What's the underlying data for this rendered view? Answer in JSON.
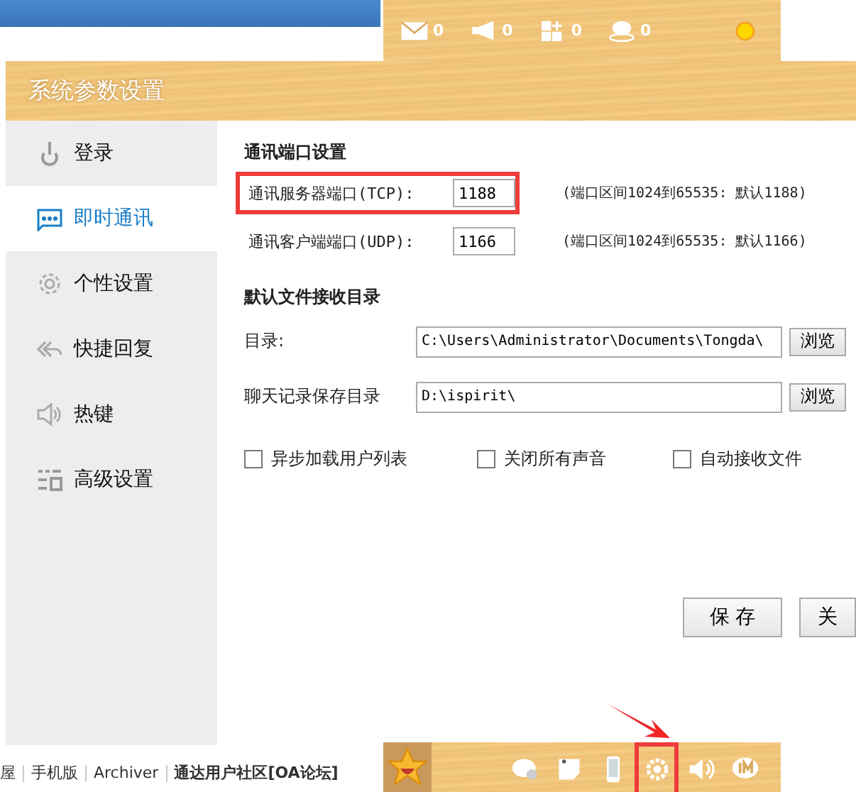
{
  "background_page": {
    "footer": [
      {
        "text": "屋",
        "bold": false
      },
      {
        "text": "手机版",
        "bold": false
      },
      {
        "text": "Archiver",
        "bold": false
      },
      {
        "text": "通达用户社区[OA论坛]",
        "bold": true
      }
    ]
  },
  "top_toolbar": {
    "counters": [
      {
        "kind": "mail",
        "count": "0"
      },
      {
        "kind": "megaphone",
        "count": "0"
      },
      {
        "kind": "apps",
        "count": "0"
      },
      {
        "kind": "chat",
        "count": "0"
      }
    ]
  },
  "dialog": {
    "title": "系统参数设置",
    "nav": [
      {
        "label": "登录",
        "kind": "power",
        "selected": false
      },
      {
        "label": "即时通讯",
        "kind": "message",
        "selected": true
      },
      {
        "label": "个性设置",
        "kind": "gear",
        "selected": false
      },
      {
        "label": "快捷回复",
        "kind": "reply",
        "selected": false
      },
      {
        "label": "热键",
        "kind": "speaker",
        "selected": false
      },
      {
        "label": "高级设置",
        "kind": "advanced",
        "selected": false
      }
    ],
    "port_section": "通讯端口设置",
    "ports": [
      {
        "label": "通讯服务器端口(TCP):",
        "value": "1188",
        "hint": "(端口区间1024到65535: 默认1188)",
        "highlighted": true
      },
      {
        "label": "通讯客户端端口(UDP):",
        "value": "1166",
        "hint": "(端口区间1024到65535: 默认1166)",
        "highlighted": false
      }
    ],
    "dir_section": "默认文件接收目录",
    "dirs": [
      {
        "label": "目录:",
        "value": "C:\\Users\\Administrator\\Documents\\Tongda\\",
        "button": "浏览"
      },
      {
        "label": "聊天记录保存目录",
        "value": "D:\\ispirit\\",
        "button": "浏览"
      }
    ],
    "options": [
      {
        "label": "异步加载用户列表",
        "checked": false
      },
      {
        "label": "关闭所有声音",
        "checked": false
      },
      {
        "label": "自动接收文件",
        "checked": false
      }
    ],
    "buttons": [
      "保 存",
      "关"
    ]
  },
  "taskbar": {
    "icons": [
      {
        "kind": "chat-add",
        "highlighted": false
      },
      {
        "kind": "note",
        "highlighted": false
      },
      {
        "kind": "phone",
        "highlighted": false
      },
      {
        "kind": "settings",
        "highlighted": true
      },
      {
        "kind": "volume",
        "highlighted": false
      },
      {
        "kind": "im",
        "highlighted": false
      }
    ]
  }
}
